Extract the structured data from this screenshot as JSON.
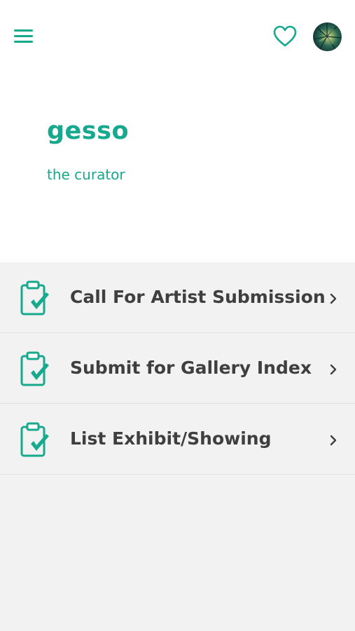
{
  "header": {
    "menu_icon": "hamburger-menu-icon",
    "favorite_icon": "heart-outline-icon",
    "avatar": "user-avatar-image"
  },
  "brand": {
    "title": "gesso",
    "subtitle": "the curator"
  },
  "menu": {
    "items": [
      {
        "label": "Call For Artist Submission",
        "icon": "clipboard-check-icon"
      },
      {
        "label": "Submit for Gallery Index",
        "icon": "clipboard-check-icon"
      },
      {
        "label": "List Exhibit/Showing",
        "icon": "clipboard-check-icon"
      }
    ],
    "chevron_icon": "chevron-right-icon"
  },
  "colors": {
    "accent": "#17a98e",
    "background": "#f2f2f2",
    "header_background": "#ffffff",
    "text": "#3f3f3f"
  }
}
